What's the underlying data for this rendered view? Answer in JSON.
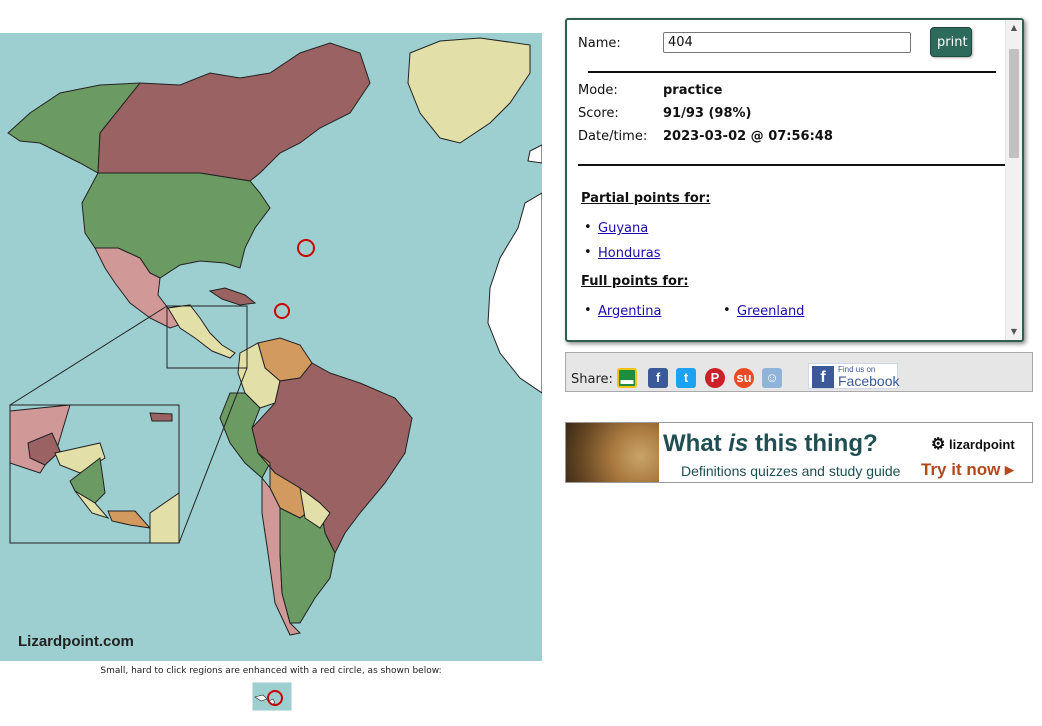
{
  "map": {
    "watermark": "Lizardpoint.com",
    "note": "Small, hard to click regions are enhanced with a red circle, as shown below:",
    "colors": {
      "ocean": "#9ecfd0",
      "green": "#6b9a63",
      "maroon": "#9a6262",
      "pink": "#d19898",
      "tan": "#e3dfa8",
      "orange": "#d39a5f",
      "white": "#ffffff",
      "highlight": "#cc0000"
    }
  },
  "result": {
    "name_label": "Name:",
    "name_value": "404",
    "print_label": "print",
    "mode_label": "Mode:",
    "mode_value": "practice",
    "score_label": "Score:",
    "score_value": "91/93 (98%)",
    "datetime_label": "Date/time:",
    "datetime_value": "2023-03-02 @ 07:56:48",
    "partial_title": "Partial points for:",
    "partial_items": [
      "Guyana",
      "Honduras"
    ],
    "full_title": "Full points for:",
    "full_items": [
      "Argentina",
      "Greenland"
    ]
  },
  "share": {
    "label": "Share:",
    "icons": [
      "google-classroom-icon",
      "facebook-icon",
      "twitter-icon",
      "pinterest-icon",
      "stumbleupon-icon",
      "reddit-icon"
    ],
    "facebook_find_small": "Find us on",
    "facebook_find_big": "Facebook"
  },
  "ad": {
    "title_pre": "What ",
    "title_em": "is",
    "title_post": " this thing?",
    "subtitle": "Definitions quizzes and study guide",
    "brand": "lizardpoint",
    "cta": "Try it now ▸"
  }
}
